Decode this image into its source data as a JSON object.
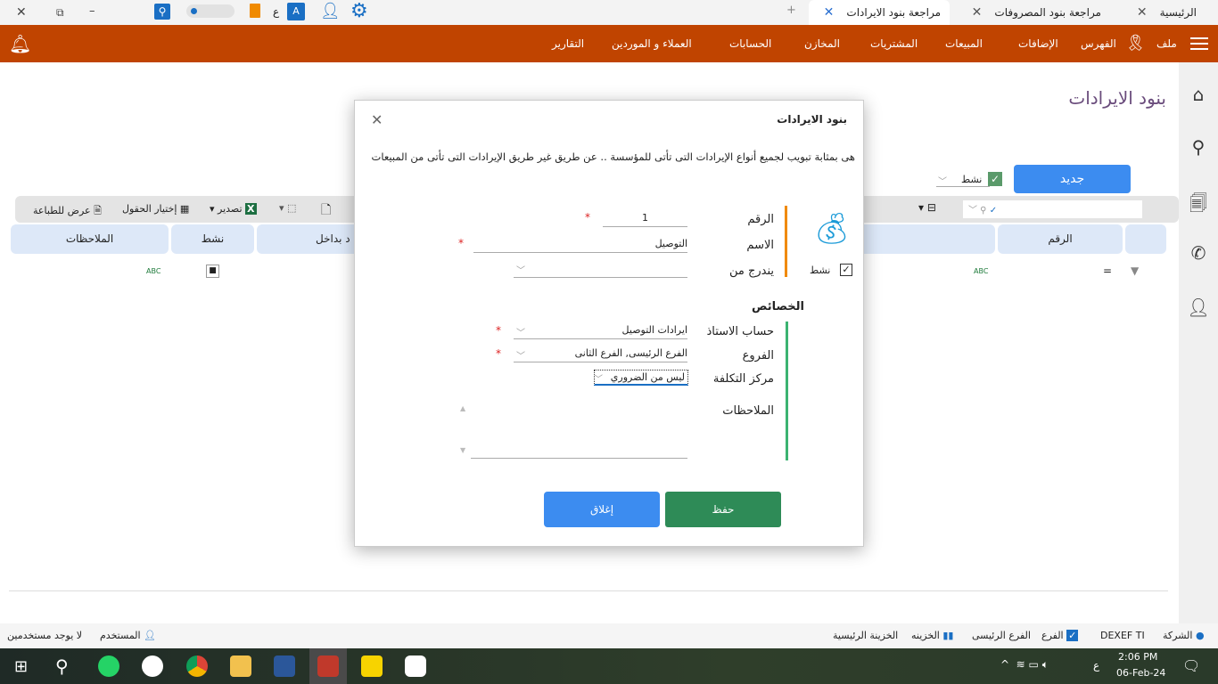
{
  "window_controls": {
    "close": "✕",
    "restore": "⧉",
    "minimize": "–"
  },
  "tabs": [
    {
      "label": "الرئيسية",
      "active": false
    },
    {
      "label": "مراجعة بنود المصروفات",
      "active": false
    },
    {
      "label": "مراجعة بنود الايرادات",
      "active": true
    }
  ],
  "add_tab": "+",
  "lang_indicator": "ع",
  "menu": [
    "ملف",
    "الفهرس",
    "الإضافات",
    "المبيعات",
    "المشتريات",
    "المخازن",
    "الحسابات",
    "العملاء و الموردين",
    "التقارير"
  ],
  "page_title": "بنود الايرادات",
  "new_button": "جديد",
  "active_filter": {
    "label": "نشط",
    "checked": true
  },
  "toolbar": {
    "print_preview": "عرض للطباعة",
    "choose_fields": "إختيار الحقول",
    "export": "تصدير"
  },
  "grid_headers": [
    "الرقم",
    "يندرج بداخل",
    "نشط",
    "الملاحظات"
  ],
  "grid_header_partial": "د بداخل",
  "dialog": {
    "title": "بنود الايرادات",
    "description": "هى بمثابة تبويب لجميع أنواع الإيرادات التى تأتى للمؤسسة .. عن طريق غير طريق الإيرادات التى تأتى من المبيعات",
    "active_label": "نشط",
    "active_checked": true,
    "number_label": "الرقم",
    "number_value": "1",
    "name_label": "الاسم",
    "name_value": "التوصيل",
    "parent_label": "يندرج من",
    "parent_value": "",
    "properties_heading": "الخصائص",
    "ledger_label": "حساب الاستاذ",
    "ledger_value": "ايرادات التوصيل",
    "branches_label": "الفروع",
    "branches_value": "الفرع الرئيسى, الفرع الثانى",
    "cost_center_label": "مركز التكلفة",
    "cost_center_value": "ليس من الضروري",
    "notes_label": "الملاحظات",
    "notes_value": "",
    "save": "حفظ",
    "close": "إغلاق",
    "required_mark": "*"
  },
  "statusbar": {
    "company_label": "الشركة",
    "company_value": "DEXEF TI",
    "branch_label": "الفرع",
    "branch_value": "الفرع الرئيسى",
    "treasury_label": "الخزينه",
    "treasury_value": "الخزينة الرئيسية",
    "user_label": "المستخدم",
    "user_value": "لا يوجد مستخدمين"
  },
  "clock": {
    "time": "2:06 PM",
    "date": "06-Feb-24"
  },
  "colors": {
    "menubar": "#c04400",
    "primary": "#3c8cf0",
    "save": "#2e8b57",
    "accent_orange": "#f08a00",
    "accent_green": "#3cb371"
  }
}
